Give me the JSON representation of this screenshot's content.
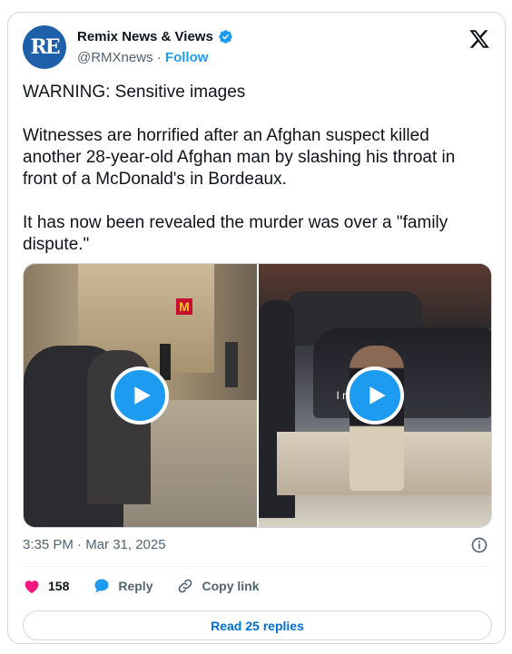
{
  "author": {
    "avatar_text": "RE",
    "display_name": "Remix News & Views",
    "handle": "@RMXnews",
    "separator": "·",
    "follow_label": "Follow"
  },
  "tweet": {
    "line1": "WARNING: Sensitive images",
    "line2": "Witnesses are horrified after an Afghan suspect killed another 28-year-old Afghan man by slashing his throat in front of a McDonald's in Bordeaux.",
    "line3": "It has now been revealed the murder was over a \"family dispute.\"",
    "timestamp": "3:35 PM · Mar 31, 2025"
  },
  "media": {
    "left_sign": "M",
    "right_overlay": "I  n"
  },
  "actions": {
    "likes_count": "158",
    "reply_label": "Reply",
    "copy_link_label": "Copy link"
  },
  "footer": {
    "read_replies_label": "Read 25 replies"
  },
  "colors": {
    "accent": "#1d9bf0",
    "like": "#f91880",
    "link": "#006fd6",
    "avatar": "#1d5fa8"
  }
}
